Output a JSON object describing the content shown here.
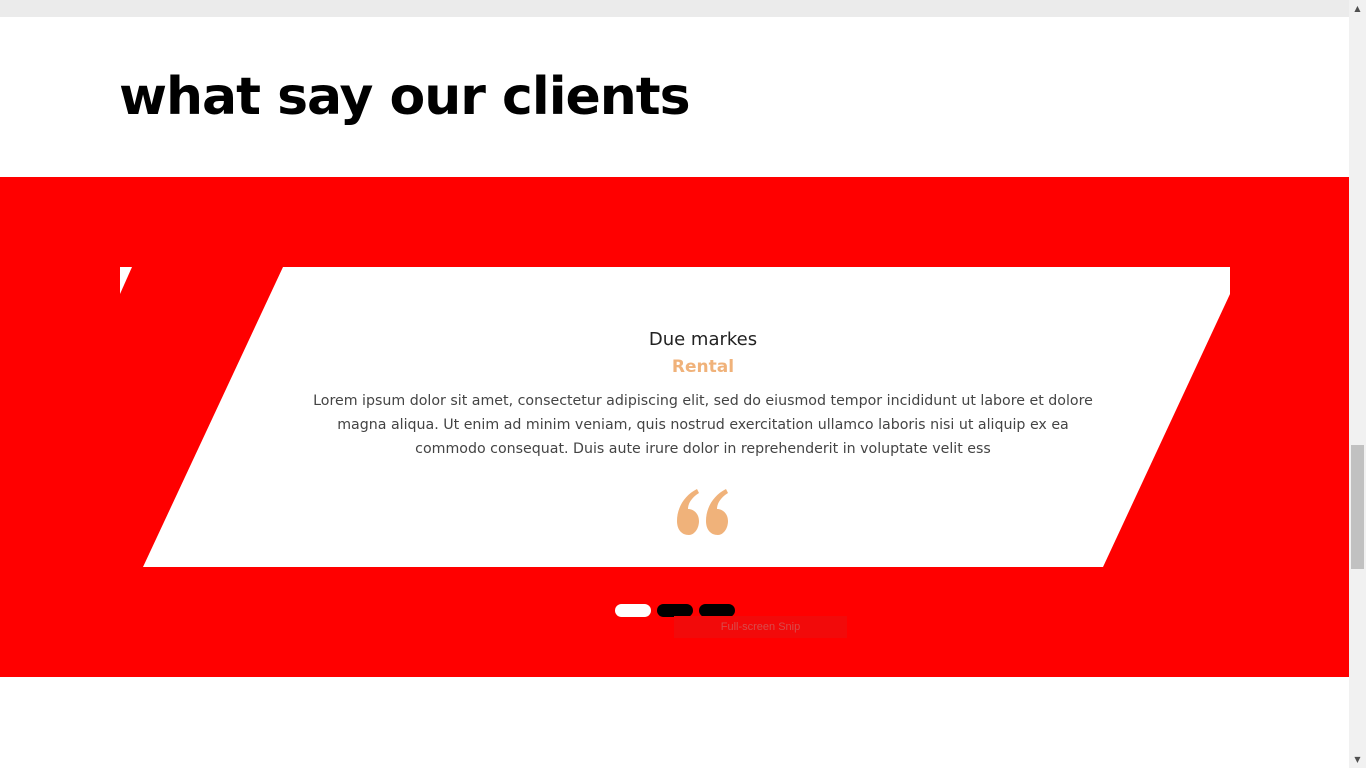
{
  "section": {
    "heading": "what say our clients"
  },
  "testimonial": {
    "name": "Due markes",
    "role": "Rental",
    "text": "Lorem ipsum dolor sit amet, consectetur adipiscing elit, sed do eiusmod tempor incididunt ut labore et dolore magna aliqua. Ut enim ad minim veniam, quis nostrud exercitation ullamco laboris nisi ut aliquip ex ea commodo consequat. Duis aute irure dolor in reprehenderit in voluptate velit ess",
    "icon": "quote-icon"
  },
  "carousel": {
    "slide_count": 3,
    "active_index": 0
  },
  "overlay": {
    "label": "Full-screen Snip"
  },
  "colors": {
    "band": "#ff0000",
    "card": "#ffffff",
    "accent": "#f0b27a",
    "heading": "#000000"
  }
}
